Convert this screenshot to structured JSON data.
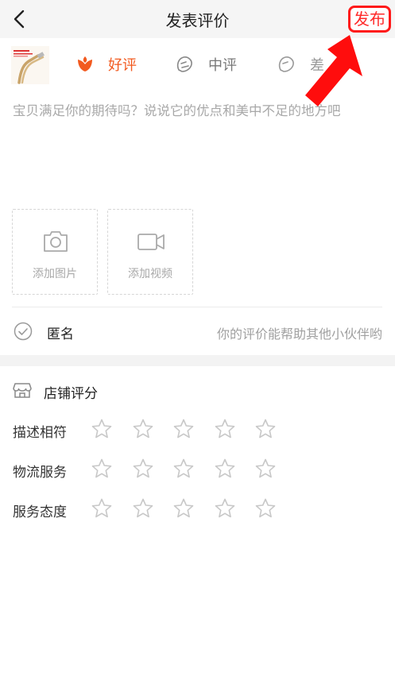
{
  "header": {
    "title": "发表评价",
    "publish_label": "发布"
  },
  "rating_types": [
    {
      "label": "好评",
      "icon": "flower-icon",
      "selected": true
    },
    {
      "label": "中评",
      "icon": "face-neutral-icon",
      "selected": false
    },
    {
      "label": "差",
      "icon": "face-bad-icon",
      "selected": false
    }
  ],
  "review": {
    "placeholder": "宝贝满足你的期待吗？说说它的优点和美中不足的地方吧",
    "value": ""
  },
  "media": {
    "add_photo_label": "添加图片",
    "add_video_label": "添加视频"
  },
  "anonymous": {
    "label": "匿名",
    "hint": "你的评价能帮助其他小伙伴哟",
    "checked": false
  },
  "shop_rating": {
    "title": "店铺评分",
    "rows": [
      {
        "label": "描述相符",
        "stars": 0,
        "max": 5
      },
      {
        "label": "物流服务",
        "stars": 0,
        "max": 5
      },
      {
        "label": "服务态度",
        "stars": 0,
        "max": 5
      }
    ]
  },
  "colors": {
    "accent": "#f25a1f",
    "highlight_border": "#ff1a1a",
    "star_outline": "#c8c8c8",
    "background_band": "#f3f3f3"
  }
}
